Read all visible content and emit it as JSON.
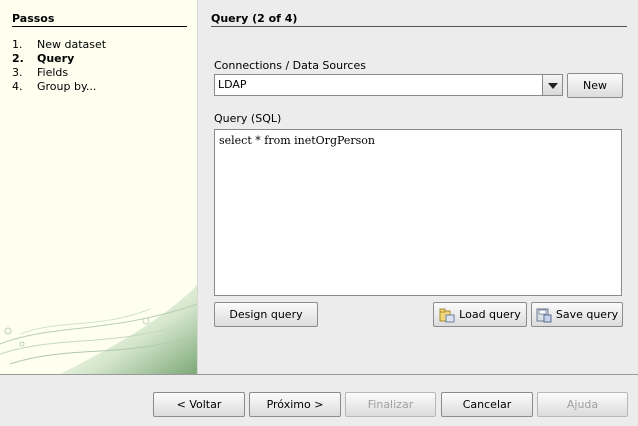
{
  "sidebar": {
    "title": "Passos",
    "steps": [
      {
        "num": "1.",
        "label": "New dataset"
      },
      {
        "num": "2.",
        "label": "Query"
      },
      {
        "num": "3.",
        "label": "Fields"
      },
      {
        "num": "4.",
        "label": "Group by..."
      }
    ],
    "active_step": 2
  },
  "main": {
    "title": "Query (2 of 4)",
    "connections_label": "Connections / Data Sources",
    "connection_value": "LDAP",
    "new_button": "New",
    "query_label": "Query (SQL)",
    "query_text": "select * from inetOrgPerson",
    "design_query_button": "Design query",
    "load_query_button": "Load query",
    "save_query_button": "Save query"
  },
  "footer": {
    "back_button": "< Voltar",
    "next_button": "Próximo >",
    "finish_button": "Finalizar",
    "cancel_button": "Cancelar",
    "help_button": "Ajuda"
  },
  "icons": {
    "dropdown": "chevron-down-icon",
    "load": "folder-open-icon",
    "save": "save-disk-icon"
  },
  "colors": {
    "sidebar_bg": "#fffff0",
    "window_bg": "#ececec",
    "disabled_text": "#a0a0a0"
  }
}
